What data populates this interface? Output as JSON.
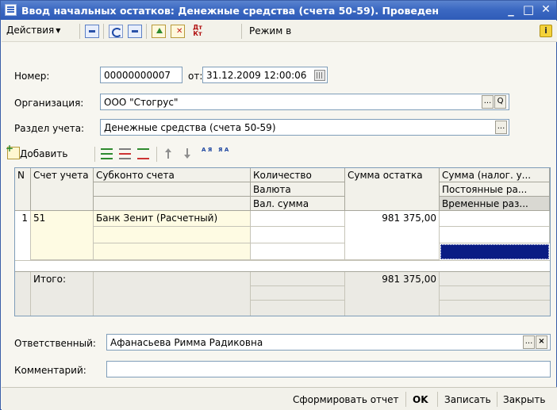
{
  "window": {
    "title": "Ввод начальных остатков: Денежные средства (счета 50-59). Проведен",
    "minimize": "_",
    "maximize": "□",
    "close": "✕"
  },
  "toolbar": {
    "actions_label": "Действия",
    "mode_label": "Режим в",
    "dtkt_icon_text": "Дт Кт",
    "info_text": "i"
  },
  "form": {
    "number_label": "Номер:",
    "number_value": "00000000007",
    "date_label": "от:",
    "date_value": "31.12.2009 12:00:06",
    "org_label": "Организация:",
    "org_value": "ООО \"Стогрус\"",
    "section_label": "Раздел учета:",
    "section_value": "Денежные средства (счета 50-59)",
    "ellipsis": "...",
    "search": "Q"
  },
  "table_toolbar": {
    "add_label": "Добавить",
    "sort_asc_text": "А Я",
    "sort_desc_text": "Я А"
  },
  "table": {
    "columns": {
      "n": "N",
      "account": "Счет учета",
      "subconto": "Субконто счета",
      "qty": "Количество",
      "currency": "Валюта",
      "cur_sum": "Вал. сумма",
      "balance": "Сумма остатка",
      "tax_sum": "Сумма (налог. у...",
      "permanent": "Постоянные ра...",
      "temporary": "Временные раз..."
    },
    "rows": [
      {
        "n": "1",
        "account": "51",
        "subconto": "Банк Зенит (Расчетный)",
        "balance": "981 375,00"
      }
    ],
    "total_label": "Итого:",
    "total_balance": "981 375,00"
  },
  "responsible": {
    "label": "Ответственный:",
    "value": "Афанасьева Римма Радиковна",
    "clear": "×"
  },
  "comment": {
    "label": "Комментарий:",
    "value": ""
  },
  "footer": {
    "report": "Сформировать отчет",
    "ok": "OK",
    "save": "Записать",
    "close": "Закрыть"
  }
}
